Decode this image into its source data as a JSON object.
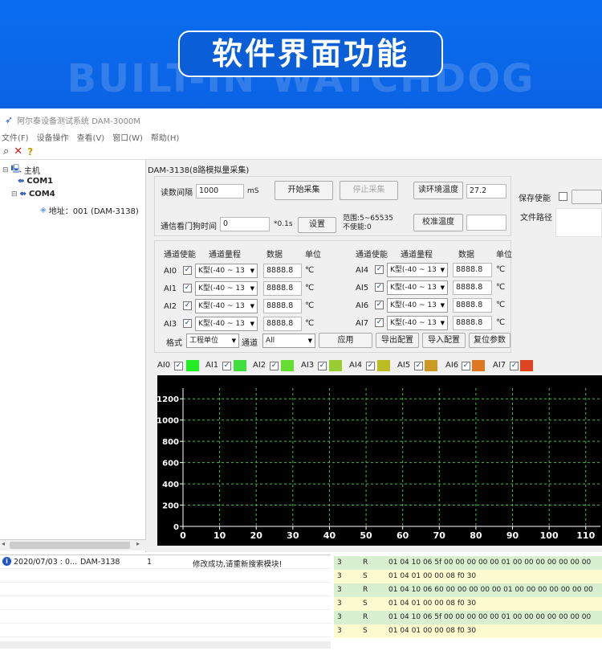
{
  "banner": {
    "title": "软件界面功能",
    "watermark": "BUILT-IN WATCHDOG"
  },
  "window": {
    "title": "阿尔泰设备测试系统 DAM-3000M"
  },
  "menu": [
    "文件(F)",
    "设备操作",
    "查看(V)",
    "窗口(W)",
    "帮助(H)"
  ],
  "tree": {
    "root": "主机",
    "com1": "COM1",
    "com4": "COM4",
    "device": "地址：001 (DAM-3138)"
  },
  "panel": {
    "title": "DAM-3138(8路模拟量采集)",
    "read_interval_label": "读数间隔",
    "read_interval_value": "1000",
    "read_interval_unit": "mS",
    "start_btn": "开始采集",
    "stop_btn": "停止采集",
    "read_temp_btn": "读环境温度",
    "temp_value": "27.2",
    "save_enable_label": "保存使能",
    "file_path_label": "文件路径",
    "watchdog_label": "通信看门狗时间",
    "watchdog_value": "0",
    "watchdog_unit": "*0.1s",
    "set_btn": "设置",
    "range_line1": "范围:5~65535",
    "range_line2": "不使能:0",
    "calib_btn": "校准温度"
  },
  "channels": {
    "headers": [
      "通道使能",
      "通道量程",
      "数据",
      "单位"
    ],
    "left": [
      {
        "name": "AI0",
        "range": "K型(-40 ~ 13",
        "value": "8888.8",
        "unit": "℃"
      },
      {
        "name": "AI1",
        "range": "K型(-40 ~ 13",
        "value": "8888.8",
        "unit": "℃"
      },
      {
        "name": "AI2",
        "range": "K型(-40 ~ 13",
        "value": "8888.8",
        "unit": "℃"
      },
      {
        "name": "AI3",
        "range": "K型(-40 ~ 13",
        "value": "8888.8",
        "unit": "℃"
      }
    ],
    "right": [
      {
        "name": "AI4",
        "range": "K型(-40 ~ 13",
        "value": "8888.8",
        "unit": "℃"
      },
      {
        "name": "AI5",
        "range": "K型(-40 ~ 13",
        "value": "8888.8",
        "unit": "℃"
      },
      {
        "name": "AI6",
        "range": "K型(-40 ~ 13",
        "value": "8888.8",
        "unit": "℃"
      },
      {
        "name": "AI7",
        "range": "K型(-40 ~ 13",
        "value": "8888.8",
        "unit": "℃"
      }
    ],
    "format_label": "格式",
    "format_value": "工程单位",
    "channel_label": "通道",
    "channel_value": "All",
    "apply_btn": "应用",
    "export_btn": "导出配置",
    "import_btn": "导入配置",
    "reset_btn": "复位参数"
  },
  "legend": [
    {
      "name": "AI0",
      "color": "#22ee22"
    },
    {
      "name": "AI1",
      "color": "#3ee03e"
    },
    {
      "name": "AI2",
      "color": "#66dd33"
    },
    {
      "name": "AI3",
      "color": "#99cc33"
    },
    {
      "name": "AI4",
      "color": "#bbbb22"
    },
    {
      "name": "AI5",
      "color": "#cc9922"
    },
    {
      "name": "AI6",
      "color": "#dd7722"
    },
    {
      "name": "AI7",
      "color": "#dd4422"
    }
  ],
  "chart_data": {
    "type": "line",
    "x_ticks": [
      "0",
      "10",
      "20",
      "30",
      "40",
      "50",
      "60",
      "70",
      "80",
      "90",
      "100",
      "110"
    ],
    "y_ticks": [
      "0",
      "200",
      "400",
      "600",
      "800",
      "1000",
      "1200"
    ],
    "xlim": [
      0,
      114
    ],
    "ylim": [
      0,
      1300
    ],
    "grid": true,
    "series": []
  },
  "log": {
    "time": "2020/07/03 : 0...",
    "device": "DAM-3138",
    "num": "1",
    "message": "修改成功,请重新搜索模块!"
  },
  "raw": [
    {
      "ch": "3",
      "dir": "R",
      "data": "01 04 10 06 5f 00 00 00 00 00 01 00 00 00 00 00 00 00",
      "tone": "g"
    },
    {
      "ch": "3",
      "dir": "S",
      "data": "01 04 01 00 00 08 f0 30",
      "tone": "y"
    },
    {
      "ch": "3",
      "dir": "R",
      "data": "01 04 10 06 60 00 00 00 00 00 01 00 00 00 00 00 00 00",
      "tone": "g"
    },
    {
      "ch": "3",
      "dir": "S",
      "data": "01 04 01 00 00 08 f0 30",
      "tone": "y"
    },
    {
      "ch": "3",
      "dir": "R",
      "data": "01 04 10 06 5f 00 00 00 00 00 01 00 00 00 00 00 00 00",
      "tone": "g"
    },
    {
      "ch": "3",
      "dir": "S",
      "data": "01 04 01 00 00 08 f0 30",
      "tone": "y"
    }
  ]
}
